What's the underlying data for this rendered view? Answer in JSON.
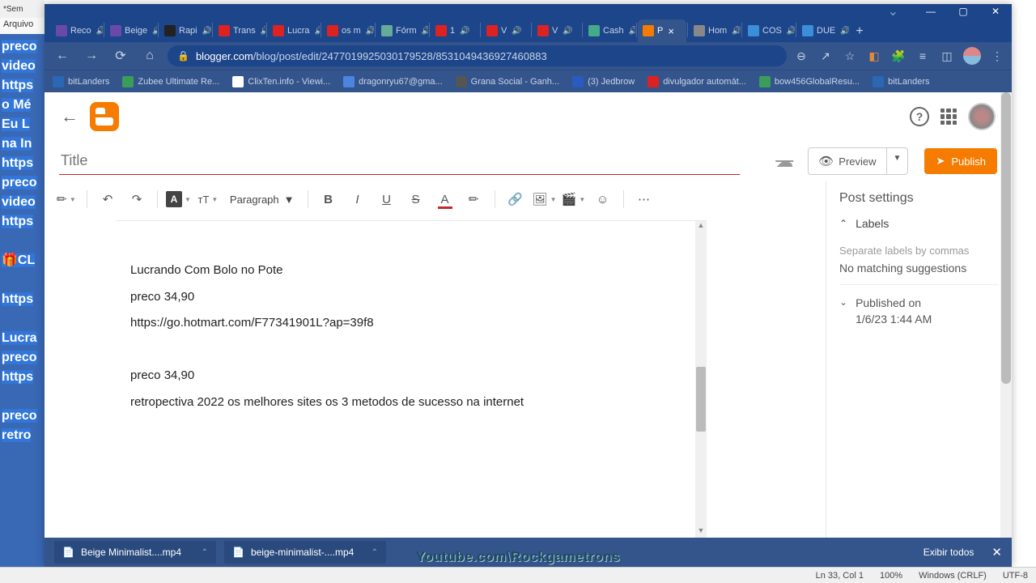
{
  "bg": {
    "title": "*Sem",
    "menu": "Arquivo",
    "lines": [
      "preco",
      "video",
      "https",
      "o Mé",
      " Eu L",
      "na In",
      "https",
      "preco",
      "video",
      "https",
      "",
      "🎁CL",
      "",
      "https",
      "",
      "Lucra",
      "preco",
      "https",
      "",
      "preco",
      "retro"
    ]
  },
  "tabs": [
    {
      "label": "Reco",
      "color": "#6a4aa8"
    },
    {
      "label": "Beige",
      "color": "#6a4aa8"
    },
    {
      "label": "Rapi",
      "color": "#222"
    },
    {
      "label": "Trans",
      "color": "#d22"
    },
    {
      "label": "Lucra",
      "color": "#d22"
    },
    {
      "label": "os m",
      "color": "#d22"
    },
    {
      "label": "Fórm",
      "color": "#6a9"
    },
    {
      "label": "1",
      "color": "#d22"
    },
    {
      "label": "V",
      "color": "#d22"
    },
    {
      "label": "V",
      "color": "#d22"
    },
    {
      "label": "Cash",
      "color": "#4a8"
    },
    {
      "label": "P",
      "color": "#f57c00",
      "active": true
    },
    {
      "label": "Hom",
      "color": "#888"
    },
    {
      "label": "COS",
      "color": "#3a8fd8"
    },
    {
      "label": "DUE",
      "color": "#3a8fd8"
    }
  ],
  "url": {
    "domain": "blogger.com",
    "path": "/blog/post/edit/2477019925030179528/8531049436927460883"
  },
  "bookmarks": [
    {
      "label": "bitLanders",
      "color": "#2a68b5"
    },
    {
      "label": "Zubee Ultimate Re...",
      "color": "#3a9e5a"
    },
    {
      "label": "ClixTen.info - Viewi...",
      "color": "#fff"
    },
    {
      "label": "dragonryu67@gma...",
      "color": "#4a85e0"
    },
    {
      "label": "Grana Social - Ganh...",
      "color": "#555"
    },
    {
      "label": "(3) Jedbrow",
      "color": "#2a5bc0"
    },
    {
      "label": "divulgador automát...",
      "color": "#d22"
    },
    {
      "label": "bow456GlobalResu...",
      "color": "#3a9e5a"
    },
    {
      "label": "bitLanders",
      "color": "#2a68b5"
    }
  ],
  "editor": {
    "title_placeholder": "Title",
    "paragraph_label": "Paragraph",
    "preview": "Preview",
    "publish": "Publish",
    "lines": [
      "Lucrando Com Bolo no Pote",
      "preco 34,90",
      "https://go.hotmart.com/F77341901L?ap=39f8",
      "",
      "preco 34,90",
      "retropectiva 2022 os melhores sites os 3 metodos de sucesso na internet"
    ]
  },
  "settings": {
    "header": "Post settings",
    "labels": "Labels",
    "labels_hint": "Separate labels by commas",
    "labels_sugg": "No matching suggestions",
    "published_on": "Published on",
    "published_date": "1/6/23 1:44 AM"
  },
  "downloads": {
    "items": [
      "Beige Minimalist....mp4",
      "beige-minimalist-....mp4"
    ],
    "show_all": "Exibir todos"
  },
  "status": {
    "pos": "Ln 33, Col 1",
    "zoom": "100%",
    "os": "Windows (CRLF)",
    "enc": "UTF-8"
  },
  "watermark": "Youtube.com\\Rockgametrons"
}
